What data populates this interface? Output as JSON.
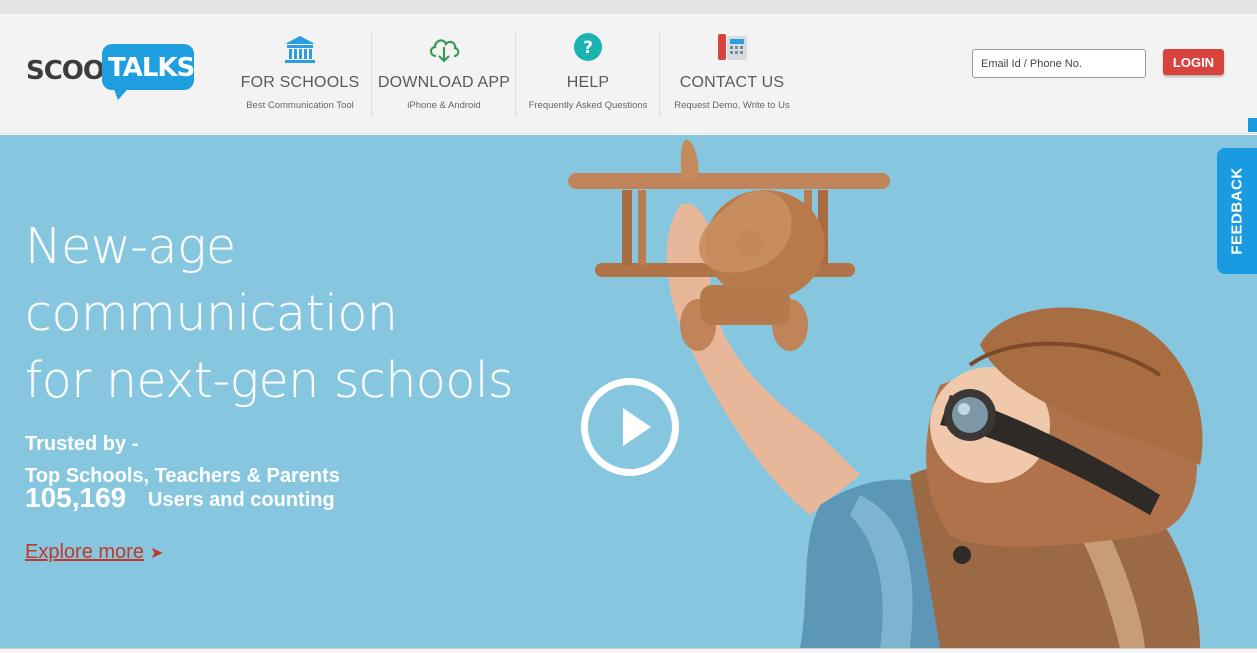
{
  "brand": {
    "logo_part1": "SCOO",
    "logo_part2": "TALKS",
    "brand_color": "#1f9ee0"
  },
  "nav": [
    {
      "title": "FOR SCHOOLS",
      "subtitle": "Best Communication Tool",
      "icon": "school-building-icon"
    },
    {
      "title": "DOWNLOAD APP",
      "subtitle": "iPhone & Android",
      "icon": "cloud-download-icon"
    },
    {
      "title": "HELP",
      "subtitle": "Frequently Asked Questions",
      "icon": "question-circle-icon"
    },
    {
      "title": "CONTACT US",
      "subtitle": "Request Demo, Write to Us",
      "icon": "phone-icon"
    }
  ],
  "login": {
    "placeholder": "Email Id / Phone No.",
    "button_label": "LOGIN",
    "button_color": "#d9433e"
  },
  "hero": {
    "headline_lines": [
      "New-age",
      "communication",
      "for next-gen schools"
    ],
    "trusted_label": "Trusted by -",
    "trusted_sub": "Top Schools, Teachers & Parents",
    "user_count": "105,169",
    "user_count_label": "Users and counting",
    "explore_label": "Explore more",
    "explore_arrow": "➤",
    "background_color": "#86c7df",
    "play_icon": "play-circle-icon"
  },
  "feedback": {
    "label": "FEEDBACK",
    "color": "#1a9ae0"
  }
}
